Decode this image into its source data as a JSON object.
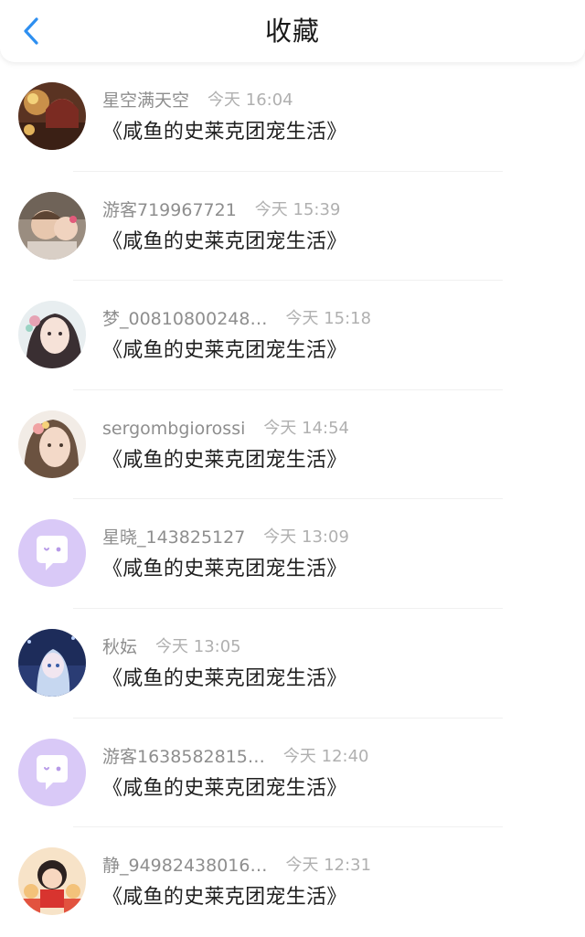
{
  "header": {
    "title": "收藏",
    "accent_color": "#2e8ff0"
  },
  "items": [
    {
      "user": "星空满天空",
      "time": "今天 16:04",
      "book": "《咸鱼的史莱克团宠生活》",
      "avatar": "photo-avatar"
    },
    {
      "user": "游客719967721",
      "time": "今天 15:39",
      "book": "《咸鱼的史莱克团宠生活》",
      "avatar": "photo-avatar"
    },
    {
      "user": "梦_00810800248…",
      "time": "今天 15:18",
      "book": "《咸鱼的史莱克团宠生活》",
      "avatar": "photo-avatar"
    },
    {
      "user": "sergombgiorossi",
      "time": "今天 14:54",
      "book": "《咸鱼的史莱克团宠生活》",
      "avatar": "photo-avatar"
    },
    {
      "user": "星晓_143825127",
      "time": "今天 13:09",
      "book": "《咸鱼的史莱克团宠生活》",
      "avatar": "default-chat-avatar"
    },
    {
      "user": "秋妘",
      "time": "今天 13:05",
      "book": "《咸鱼的史莱克团宠生活》",
      "avatar": "photo-avatar"
    },
    {
      "user": "游客1638582815…",
      "time": "今天 12:40",
      "book": "《咸鱼的史莱克团宠生活》",
      "avatar": "default-chat-avatar"
    },
    {
      "user": "静_94982438016…",
      "time": "今天 12:31",
      "book": "《咸鱼的史莱克团宠生活》",
      "avatar": "photo-avatar"
    }
  ],
  "colors": {
    "default_avatar_bg": "#d9c9f7"
  }
}
